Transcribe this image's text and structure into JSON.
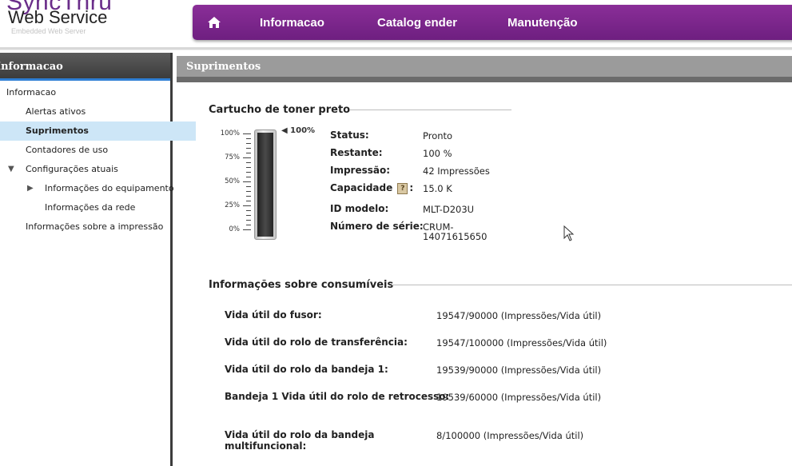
{
  "brand": {
    "top_text": "SyncThru",
    "title": "Web Service",
    "subtitle": "Embedded Web Server"
  },
  "topnav": {
    "home_icon": "home-icon",
    "items": [
      "Informacao",
      "Catalog ender",
      "Manutenção"
    ]
  },
  "sidebar": {
    "header": "Informacao",
    "items": [
      {
        "label": "Informacao"
      },
      {
        "label": "Alertas ativos"
      },
      {
        "label": "Suprimentos",
        "active": true
      },
      {
        "label": "Contadores de uso"
      },
      {
        "label": "Configurações atuais",
        "expanded": true
      },
      {
        "label": "Informações do equipamento"
      },
      {
        "label": "Informações da rede"
      },
      {
        "label": "Informações sobre a impressão"
      }
    ]
  },
  "page": {
    "title": "Suprimentos"
  },
  "toner": {
    "section_title": "Cartucho de toner preto",
    "level_label": "100%",
    "level": 1.0,
    "ticks": [
      "100%",
      "75%",
      "50%",
      "25%",
      "0%"
    ],
    "fields": [
      {
        "label": "Status:",
        "value": "Pronto"
      },
      {
        "label": "Restante:",
        "value": "100 %"
      },
      {
        "label": "Impressão:",
        "value": "42 Impressões"
      },
      {
        "label": "Capacidade",
        "label_suffix": ":",
        "help": "?",
        "value": "15.0 K"
      },
      {
        "label": "ID modelo:",
        "value": "MLT-D203U"
      },
      {
        "label": "Número de série:",
        "value_line1": "CRUM-",
        "value_line2": "14071615650"
      }
    ]
  },
  "consumables": {
    "section_title": "Informações sobre consumíveis",
    "rows": [
      {
        "label": "Vida útil do fusor:",
        "value": "19547/90000 (Impressões/Vida útil)"
      },
      {
        "label": "Vida útil do rolo de transferência:",
        "value": "19547/100000 (Impressões/Vida útil)"
      },
      {
        "label": "Vida útil do rolo da bandeja 1:",
        "value": "19539/90000 (Impressões/Vida útil)"
      },
      {
        "label": "Bandeja 1 Vida útil do rolo de retrocesso:",
        "value": "19539/60000 (Impressões/Vida útil)"
      },
      {
        "label_line1": "Vida útil do rolo da bandeja",
        "label_line2": "multifuncional:",
        "value": "8/100000 (Impressões/Vida útil)"
      }
    ]
  },
  "colors": {
    "nav_purple": "#7a2590",
    "active_item": "#cde6f7",
    "accent_blue": "#2f7fd4"
  }
}
